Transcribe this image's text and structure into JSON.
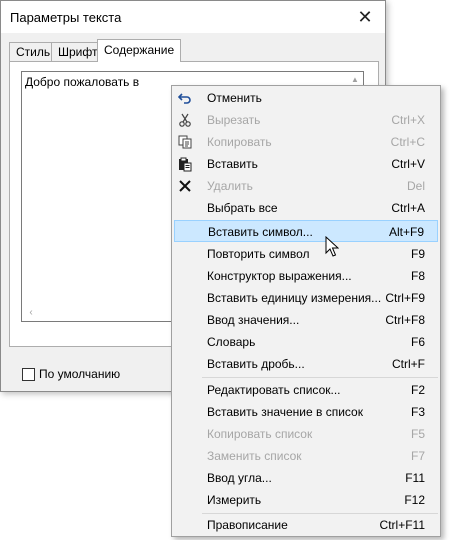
{
  "dialog": {
    "title": "Параметры текста",
    "tabs": [
      "Стиль",
      "Шрифт",
      "Содержание"
    ],
    "text_content": "Добро пожаловать в",
    "default_checkbox_label": "По умолчанию"
  },
  "menu": {
    "items": [
      {
        "label": "Отменить",
        "shortcut": "",
        "icon": "undo-icon",
        "enabled": true
      },
      {
        "label": "Вырезать",
        "shortcut": "Ctrl+X",
        "icon": "scissors-icon",
        "enabled": false
      },
      {
        "label": "Копировать",
        "shortcut": "Ctrl+C",
        "icon": "copy-icon",
        "enabled": false
      },
      {
        "label": "Вставить",
        "shortcut": "Ctrl+V",
        "icon": "paste-icon",
        "enabled": true
      },
      {
        "label": "Удалить",
        "shortcut": "Del",
        "icon": "delete-icon",
        "enabled": false
      },
      {
        "label": "Выбрать все",
        "shortcut": "Ctrl+A",
        "icon": "",
        "enabled": true
      },
      {
        "label": "Вставить символ...",
        "shortcut": "Alt+F9",
        "icon": "",
        "enabled": true
      },
      {
        "label": "Повторить символ",
        "shortcut": "F9",
        "icon": "",
        "enabled": true
      },
      {
        "label": "Конструктор выражения...",
        "shortcut": "F8",
        "icon": "",
        "enabled": true
      },
      {
        "label": "Вставить единицу измерения...",
        "shortcut": "Ctrl+F9",
        "icon": "",
        "enabled": true
      },
      {
        "label": "Ввод значения...",
        "shortcut": "Ctrl+F8",
        "icon": "",
        "enabled": true
      },
      {
        "label": "Словарь",
        "shortcut": "F6",
        "icon": "",
        "enabled": true
      },
      {
        "label": "Вставить дробь...",
        "shortcut": "Ctrl+F",
        "icon": "",
        "enabled": true
      },
      {
        "label": "Редактировать список...",
        "shortcut": "F2",
        "icon": "",
        "enabled": true
      },
      {
        "label": "Вставить значение в список",
        "shortcut": "F3",
        "icon": "",
        "enabled": true
      },
      {
        "label": "Копировать список",
        "shortcut": "F5",
        "icon": "",
        "enabled": false
      },
      {
        "label": "Заменить список",
        "shortcut": "F7",
        "icon": "",
        "enabled": false
      },
      {
        "label": "Ввод угла...",
        "shortcut": "F11",
        "icon": "",
        "enabled": true
      },
      {
        "label": "Измерить",
        "shortcut": "F12",
        "icon": "",
        "enabled": true
      },
      {
        "label": "Правописание",
        "shortcut": "Ctrl+F11",
        "icon": "",
        "enabled": true
      }
    ]
  }
}
